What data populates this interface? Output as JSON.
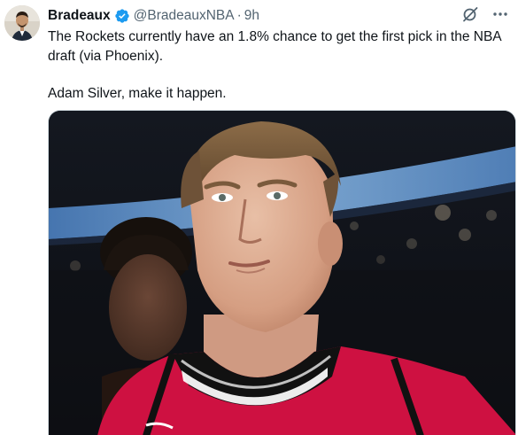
{
  "author": {
    "display_name": "Bradeaux",
    "handle": "@BradeauxNBA",
    "separator": "·",
    "time": "9h",
    "verified": true,
    "avatar_icon": "person-avatar"
  },
  "tweet": {
    "lines": [
      "The Rockets currently have an 1.8% chance to get the first pick in the NBA draft (via Phoenix).",
      "Adam Silver, make it happen."
    ]
  },
  "icons": {
    "verified": "verified-badge-icon",
    "grok": "grok-icon",
    "more": "more-options-icon"
  },
  "colors": {
    "verified_blue": "#1d9bf0",
    "text": "#0f1419",
    "secondary": "#536471",
    "jersey_red": "#ce1141"
  }
}
